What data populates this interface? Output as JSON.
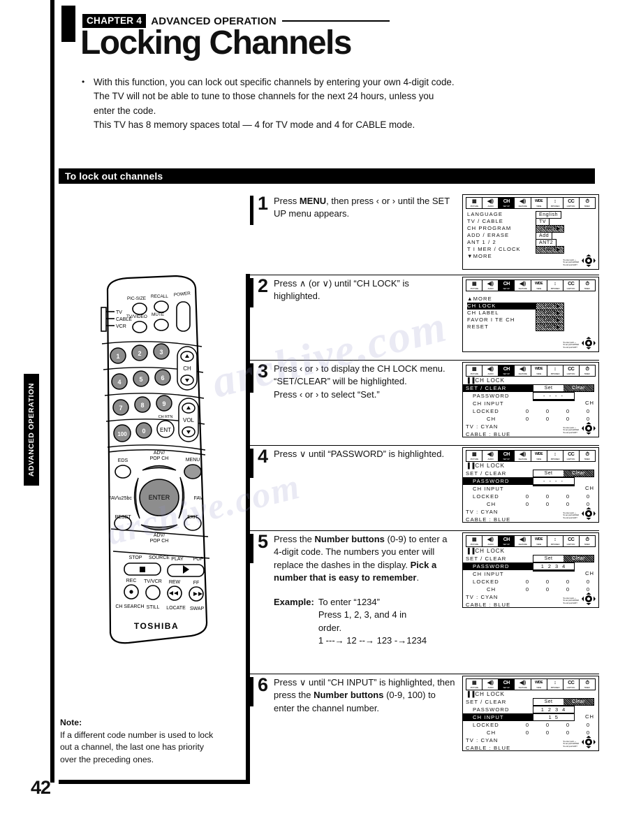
{
  "page": {
    "number": "42",
    "side_tab": "ADVANCED OPERATION",
    "chapter_badge": "CHAPTER 4",
    "chapter_title": "ADVANCED OPERATION",
    "title": "Locking Channels"
  },
  "intro": {
    "bullet": "•",
    "line1": "With this function, you can lock out specific channels by entering your own 4-digit code.",
    "line2": "The TV will not be able to tune to those channels for the next 24 hours, unless you",
    "line3": "enter the code.",
    "line4": "This TV has 8 memory spaces total — 4 for TV mode and 4 for CABLE mode."
  },
  "section": {
    "title": "To lock out channels"
  },
  "steps": [
    {
      "number": "1",
      "text_parts": [
        {
          "t": "Press ",
          "b": false
        },
        {
          "t": "MENU",
          "b": true
        },
        {
          "t": ", then press ‹ or › until the SET UP menu appears.",
          "b": false
        }
      ]
    },
    {
      "number": "2",
      "text_parts": [
        {
          "t": "Press ∧ (or ∨) until “CH LOCK” is highlighted.",
          "b": false
        }
      ]
    },
    {
      "number": "3",
      "text_parts": [
        {
          "t": "Press ‹ or › to display the CH LOCK menu.",
          "b": false
        },
        {
          "t": "“SET/CLEAR” will be highlighted.",
          "b": false,
          "br": true
        },
        {
          "t": "Press ‹ or › to select “Set.”",
          "b": false,
          "br": true
        }
      ]
    },
    {
      "number": "4",
      "text_parts": [
        {
          "t": "Press ∨ until “PASSWORD” is highlighted.",
          "b": false
        }
      ]
    },
    {
      "number": "5",
      "text_parts": [
        {
          "t": "Press the ",
          "b": false
        },
        {
          "t": "Number buttons",
          "b": true
        },
        {
          "t": " (0-9) to enter a 4-digit code. The numbers you enter will replace the dashes in the display.",
          "b": false
        },
        {
          "t": "Pick a number that is easy to remember",
          "b": true,
          "br": true
        },
        {
          "t": ".",
          "b": false
        }
      ],
      "example": {
        "label": "Example:",
        "line1": "To enter “1234”",
        "line2": "Press 1, 2, 3, and 4 in",
        "line3": "order.",
        "line4": "1 ---→ 12 --→ 123 -→1234"
      }
    },
    {
      "number": "6",
      "text_parts": [
        {
          "t": "Press ∨ until “CH INPUT” is highlighted, then press the ",
          "b": false
        },
        {
          "t": "Number buttons",
          "b": true
        },
        {
          "t": " (0-9, 100) to enter the channel number.",
          "b": false
        }
      ]
    }
  ],
  "osd_iconbar": [
    {
      "glyph": "◧",
      "cap": "PICTURE",
      "selected": false
    },
    {
      "glyph": "◀))",
      "cap": "AUDIO",
      "selected": false
    },
    {
      "glyph": "CH",
      "cap": "SET UP",
      "selected": true
    },
    {
      "glyph": "◀))",
      "cap": "FEATURE",
      "selected": false
    },
    {
      "glyph": "WIDE",
      "cap": "WIDE",
      "selected": false
    },
    {
      "glyph": "↕",
      "cap": "PIP/VIDEO",
      "selected": false
    },
    {
      "glyph": "CC",
      "cap": "CAPTION",
      "selected": false
    },
    {
      "glyph": "⏱",
      "cap": "TIMER",
      "selected": false
    }
  ],
  "osd_note": {
    "l1": "To enter push ‹ ›",
    "l2": "To set push ENTER",
    "l3": "To end push EXIT"
  },
  "osd_setup": {
    "rows": [
      {
        "label": "LANGUAGE",
        "value": "English",
        "shaded": false
      },
      {
        "label": "TV / CABLE",
        "value": "TV",
        "shaded": false
      },
      {
        "label": "CH  PROGRAM",
        "value": "START▶",
        "shaded": true
      },
      {
        "label": "ADD / ERASE",
        "value": "Add",
        "shaded": false
      },
      {
        "label": "ANT 1 / 2",
        "value": "ANT2",
        "shaded": false
      },
      {
        "label": "T I MER / CLOCK",
        "value": "START▶",
        "shaded": true
      },
      {
        "label": "▼MORE",
        "value": "",
        "shaded": false
      }
    ]
  },
  "osd_more": {
    "rows": [
      {
        "label": "▲MORE",
        "value": "",
        "shaded": false,
        "highlight": false
      },
      {
        "label": "CH  LOCK",
        "value": "START▶",
        "shaded": true,
        "highlight": true
      },
      {
        "label": "CH  LABEL",
        "value": "START▶",
        "shaded": true,
        "highlight": false
      },
      {
        "label": "FAVOR I TE  CH",
        "value": "START▶",
        "shaded": true,
        "highlight": false
      },
      {
        "label": "RESET",
        "value": "START▶",
        "shaded": true,
        "highlight": false
      }
    ]
  },
  "osd_chlock": {
    "title": "▐▐CH  LOCK",
    "set_label": "Set",
    "clear_label": "Clear",
    "ch_suffix": "CH",
    "tv_line": "TV : CYAN",
    "cable_line": "CABLE : BLUE",
    "rows": {
      "setclear": "SET / CLEAR",
      "password": "PASSWORD",
      "chinput": "CH  INPUT",
      "locked": "LOCKED",
      "ch": "CH"
    },
    "locked_values": [
      "0",
      "0",
      "0",
      "0"
    ],
    "ch_values": [
      "0",
      "0",
      "0",
      "0"
    ],
    "states": {
      "step3": {
        "highlight": "setclear",
        "password": "- - - -",
        "chinput": ""
      },
      "step4": {
        "highlight": "password",
        "password": "- - - -",
        "chinput": ""
      },
      "step5": {
        "highlight": "password",
        "password": "1 2 3 4",
        "chinput": ""
      },
      "step6": {
        "highlight": "chinput",
        "password": "1 2 3 4",
        "chinput": "1 5"
      }
    }
  },
  "remote": {
    "brand": "TOSHIBA",
    "switch_labels": [
      "TV",
      "CABLE",
      "VCR"
    ],
    "top_buttons": [
      "PIC-SIZE",
      "RECALL",
      "POWER",
      "TV/VIDEO",
      "MUTE"
    ],
    "number_keys": [
      "1",
      "2",
      "3",
      "4",
      "5",
      "6",
      "7",
      "8",
      "9",
      "100",
      "0",
      "ENT"
    ],
    "ch_label": "CH",
    "vol_label": "VOL",
    "ch_rtn_label": "CH RTN",
    "mid_buttons": [
      "EDS",
      "ADV/\nPOP  CH",
      "MENU",
      "FAV▼",
      "ENTER",
      "FAV▲",
      "RESET",
      "EXIT"
    ],
    "bottom_row1": [
      "STOP",
      "SOURCE",
      "PLAY",
      "POP"
    ],
    "bottom_row2": [
      "REC",
      "TV/VCR",
      "REW",
      "FF"
    ],
    "bottom_row3": [
      "CH SEARCH",
      "STILL",
      "LOCATE",
      "SWAP"
    ]
  },
  "note": {
    "heading": "Note:",
    "line1": "If a different code number is used to lock",
    "line2": "out a channel, the last one has priority",
    "line3": "over the preceding ones."
  },
  "watermark": {
    "text": "archive.com"
  }
}
